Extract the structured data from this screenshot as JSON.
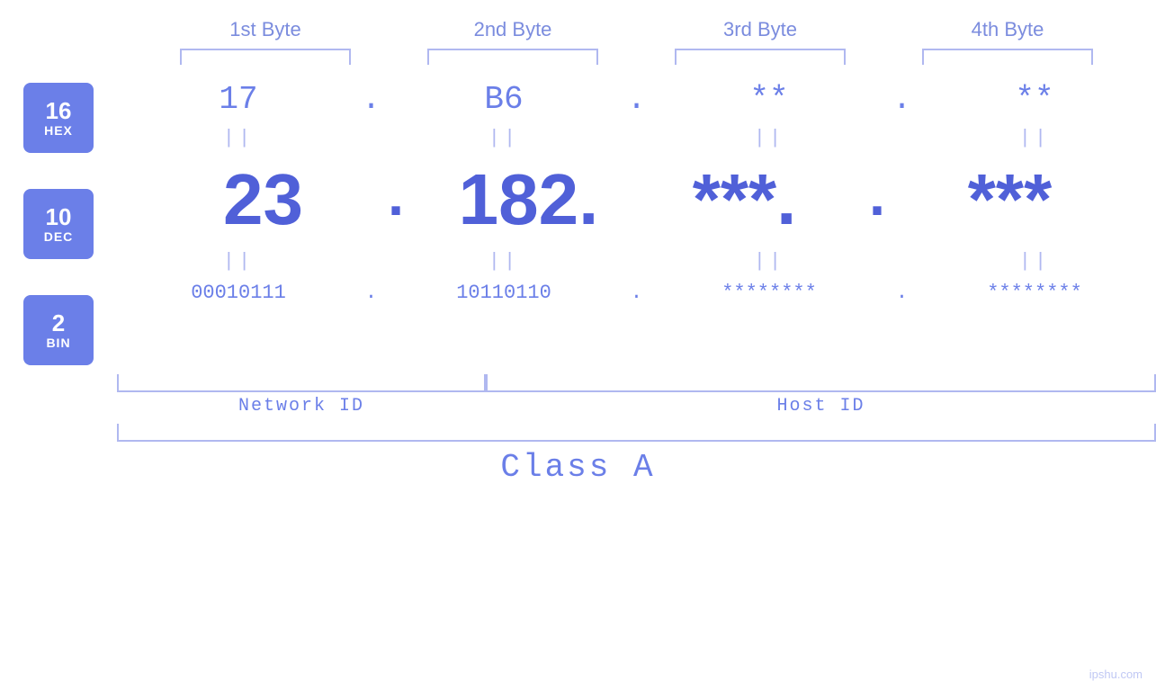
{
  "byteLabels": [
    "1st Byte",
    "2nd Byte",
    "3rd Byte",
    "4th Byte"
  ],
  "badges": [
    {
      "number": "16",
      "label": "HEX"
    },
    {
      "number": "10",
      "label": "DEC"
    },
    {
      "number": "2",
      "label": "BIN"
    }
  ],
  "hexRow": {
    "values": [
      "17",
      "B6",
      "**",
      "**"
    ],
    "dots": [
      ".",
      ".",
      "."
    ]
  },
  "decRow": {
    "values": [
      "23",
      "182.",
      "***.",
      "***"
    ],
    "dots": [
      ".",
      ".",
      "."
    ]
  },
  "binRow": {
    "values": [
      "00010111",
      "10110110",
      "********",
      "********"
    ],
    "dots": [
      ".",
      ".",
      "."
    ]
  },
  "labels": {
    "networkId": "Network ID",
    "hostId": "Host ID",
    "classA": "Class A"
  },
  "watermark": "ipshu.com",
  "colors": {
    "accent": "#6b7fe8",
    "light": "#b0b8f0"
  }
}
